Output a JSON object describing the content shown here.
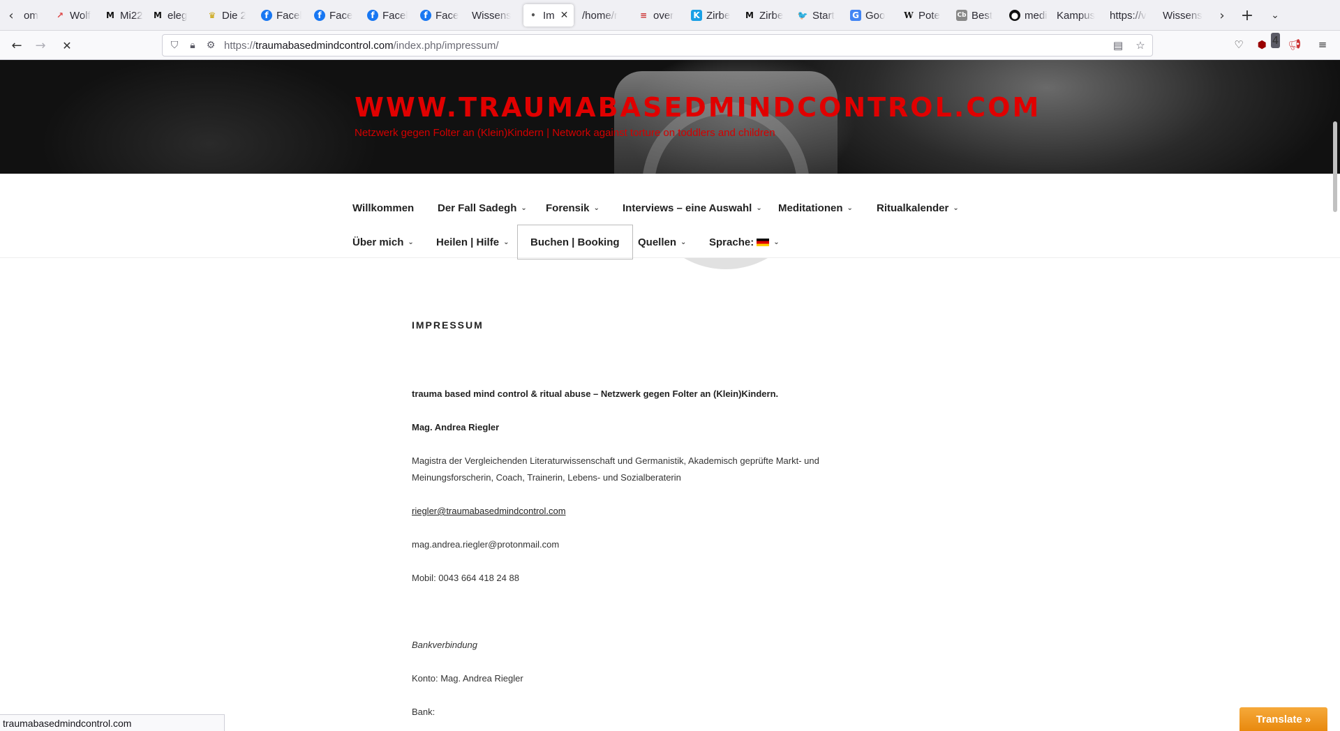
{
  "tabs": [
    {
      "label": "om",
      "icon": "page-icon",
      "color": "#888888"
    },
    {
      "label": "Wolf",
      "icon": "arrow-icon",
      "color": "#d44"
    },
    {
      "label": "Mi22",
      "icon": "m-logo-icon",
      "color": "#111"
    },
    {
      "label": "eleg",
      "icon": "m-logo-icon",
      "color": "#111"
    },
    {
      "label": "Die 2",
      "icon": "crown-icon",
      "color": "#c8a000"
    },
    {
      "label": "Facel",
      "icon": "facebook-icon",
      "color": "#1877f2"
    },
    {
      "label": "Face",
      "icon": "facebook-icon",
      "color": "#1877f2"
    },
    {
      "label": "Facel",
      "icon": "facebook-icon",
      "color": "#1877f2"
    },
    {
      "label": "Face",
      "icon": "facebook-icon",
      "color": "#1877f2"
    },
    {
      "label": "Wissens",
      "icon": "",
      "color": ""
    },
    {
      "label": "Im",
      "icon": "dot-icon",
      "color": "#555",
      "active": true
    },
    {
      "label": "/home/r",
      "icon": "",
      "color": ""
    },
    {
      "label": "over",
      "icon": "stack-icon",
      "color": "#c33"
    },
    {
      "label": "Zirbe",
      "icon": "k-logo-icon",
      "color": "#1aa0e6"
    },
    {
      "label": "Zirbe",
      "icon": "m-logo-icon",
      "color": "#111"
    },
    {
      "label": "Start",
      "icon": "twitter-icon",
      "color": "#1da1f2"
    },
    {
      "label": "Goo",
      "icon": "google-translate-icon",
      "color": "#4285f4"
    },
    {
      "label": "Pote",
      "icon": "wikipedia-icon",
      "color": "#111"
    },
    {
      "label": "Best",
      "icon": "cb-logo-icon",
      "color": "#888"
    },
    {
      "label": "medi",
      "icon": "github-icon",
      "color": "#111"
    },
    {
      "label": "Kampus",
      "icon": "",
      "color": ""
    },
    {
      "label": "https://v",
      "icon": "",
      "color": ""
    },
    {
      "label": "Wissens",
      "icon": "",
      "color": ""
    }
  ],
  "urlbar": {
    "url_prefix": "https://",
    "url_host": "traumabasedmindcontrol.com",
    "url_path": "/index.php/impressum/"
  },
  "toolbar": {
    "extension_badge": "4"
  },
  "site": {
    "title": "WWW.TRAUMABASEDMINDCONTROL.COM",
    "description": "Netzwerk gegen Folter an (Klein)Kindern | Network against torture on toddlers and children",
    "title_color": "#e00000"
  },
  "menu": {
    "row1": [
      "Willkommen",
      "Der Fall Sadegh",
      "Forensik",
      "Interviews – eine Auswahl",
      "Meditationen",
      "Ritualkalender"
    ],
    "row2": [
      "Über mich",
      "Heilen | Hilfe",
      "Buchen | Booking",
      "Quellen",
      "Sprache:"
    ]
  },
  "page": {
    "title": "IMPRESSUM",
    "intro": "trauma based mind control & ritual abuse – Netzwerk gegen Folter an (Klein)Kindern.",
    "name": "Mag. Andrea Riegler",
    "bio_line1": "Magistra der Vergleichenden Literaturwissenschaft und Germanistik, Akademisch geprüfte Markt- und",
    "bio_line2": "Meinungsforscherin, Coach, Trainerin, Lebens- und Sozialberaterin",
    "email1": "riegler@traumabasedmindcontrol.com",
    "email2": "mag.andrea.riegler@protonmail.com",
    "phone": "Mobil: 0043 664 418 24 88",
    "bank_heading": "Bankverbindung",
    "account": "Konto: Mag. Andrea Riegler",
    "bank": "Bank:"
  },
  "status": {
    "text": "traumabasedmindcontrol.com"
  },
  "translate": {
    "label": "Translate »"
  }
}
